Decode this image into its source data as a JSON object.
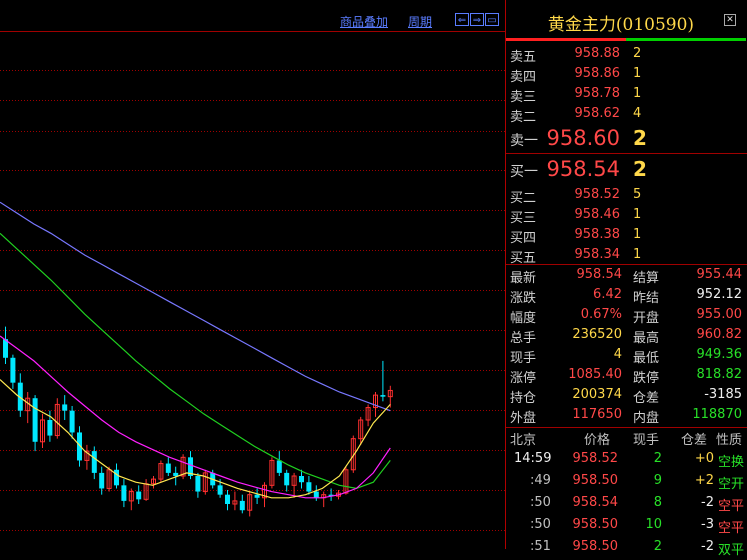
{
  "toolbar": {
    "overlay_label": "商品叠加",
    "period_label": "周期"
  },
  "quote": {
    "title": "黄金主力(010590)",
    "asks": [
      {
        "label": "卖五",
        "price": "958.88",
        "vol": "2"
      },
      {
        "label": "卖四",
        "price": "958.86",
        "vol": "1"
      },
      {
        "label": "卖三",
        "price": "958.78",
        "vol": "1"
      },
      {
        "label": "卖二",
        "price": "958.62",
        "vol": "4"
      },
      {
        "label": "卖一",
        "price": "958.60",
        "vol": "2"
      }
    ],
    "bids": [
      {
        "label": "买一",
        "price": "958.54",
        "vol": "2"
      },
      {
        "label": "买二",
        "price": "958.52",
        "vol": "5"
      },
      {
        "label": "买三",
        "price": "958.46",
        "vol": "1"
      },
      {
        "label": "买四",
        "price": "958.38",
        "vol": "1"
      },
      {
        "label": "买五",
        "price": "958.34",
        "vol": "1"
      }
    ],
    "stats": [
      {
        "l1": "最新",
        "v1": "958.54",
        "c1": "red",
        "l2": "结算",
        "v2": "955.44",
        "c2": "red"
      },
      {
        "l1": "涨跌",
        "v1": "6.42",
        "c1": "red",
        "l2": "昨结",
        "v2": "952.12",
        "c2": "white"
      },
      {
        "l1": "幅度",
        "v1": "0.67%",
        "c1": "red",
        "l2": "开盘",
        "v2": "955.00",
        "c2": "red"
      },
      {
        "l1": "总手",
        "v1": "236520",
        "c1": "yellow",
        "l2": "最高",
        "v2": "960.82",
        "c2": "red"
      },
      {
        "l1": "现手",
        "v1": "4",
        "c1": "yellow",
        "l2": "最低",
        "v2": "949.36",
        "c2": "green"
      },
      {
        "l1": "涨停",
        "v1": "1085.40",
        "c1": "red",
        "l2": "跌停",
        "v2": "818.82",
        "c2": "green"
      },
      {
        "l1": "持仓",
        "v1": "200374",
        "c1": "yellow",
        "l2": "仓差",
        "v2": "-3185",
        "c2": "white"
      },
      {
        "l1": "外盘",
        "v1": "117650",
        "c1": "red",
        "l2": "内盘",
        "v2": "118870",
        "c2": "green"
      }
    ],
    "ticks_header": {
      "time": "北京",
      "price": "价格",
      "vol": "现手",
      "diff": "仓差",
      "nature": "性质"
    },
    "ticks": [
      {
        "time": "14:59",
        "price": "958.52",
        "vol": "2",
        "diff": "+0",
        "nature": "空换",
        "nature_color": "green"
      },
      {
        "time": ":49",
        "price": "958.50",
        "vol": "9",
        "diff": "+2",
        "nature": "空开",
        "nature_color": "green"
      },
      {
        "time": ":50",
        "price": "958.54",
        "vol": "8",
        "diff": "-2",
        "nature": "空平",
        "nature_color": "red"
      },
      {
        "time": ":50",
        "price": "958.50",
        "vol": "10",
        "diff": "-3",
        "nature": "空平",
        "nature_color": "red"
      },
      {
        "time": ":51",
        "price": "958.50",
        "vol": "2",
        "diff": "-2",
        "nature": "双平",
        "nature_color": "green"
      }
    ]
  },
  "chart": {
    "candles": [
      [
        962.2,
        963.0,
        960.6,
        961.0
      ],
      [
        961.0,
        961.2,
        959.0,
        959.4
      ],
      [
        959.4,
        960.0,
        957.2,
        957.6
      ],
      [
        957.6,
        958.8,
        956.8,
        958.4
      ],
      [
        958.4,
        958.6,
        955.0,
        955.6
      ],
      [
        955.6,
        957.4,
        955.2,
        957.0
      ],
      [
        957.0,
        957.6,
        955.6,
        956.0
      ],
      [
        956.0,
        958.4,
        955.8,
        958.0
      ],
      [
        958.0,
        958.6,
        957.0,
        957.6
      ],
      [
        957.6,
        957.9,
        955.8,
        956.2
      ],
      [
        956.2,
        956.6,
        954.0,
        954.4
      ],
      [
        954.4,
        955.4,
        953.8,
        955.0
      ],
      [
        955.0,
        955.3,
        953.2,
        953.6
      ],
      [
        953.6,
        954.0,
        952.2,
        952.6
      ],
      [
        952.6,
        954.0,
        952.4,
        953.8
      ],
      [
        953.8,
        954.2,
        952.6,
        952.8
      ],
      [
        952.8,
        953.2,
        951.4,
        951.8
      ],
      [
        951.8,
        952.6,
        951.2,
        952.4
      ],
      [
        952.4,
        952.8,
        951.6,
        951.9
      ],
      [
        951.9,
        953.2,
        951.8,
        952.9
      ],
      [
        952.9,
        953.4,
        952.6,
        953.2
      ],
      [
        953.2,
        954.4,
        953.0,
        954.2
      ],
      [
        954.2,
        954.6,
        953.4,
        953.6
      ],
      [
        953.6,
        954.0,
        952.8,
        953.4
      ],
      [
        953.4,
        954.8,
        953.2,
        954.6
      ],
      [
        954.6,
        955.0,
        953.2,
        953.4
      ],
      [
        953.4,
        953.6,
        952.0,
        952.4
      ],
      [
        952.4,
        953.8,
        952.2,
        953.6
      ],
      [
        953.6,
        953.8,
        952.6,
        952.8
      ],
      [
        952.8,
        953.2,
        952.0,
        952.2
      ],
      [
        952.2,
        952.5,
        951.2,
        951.6
      ],
      [
        951.6,
        952.4,
        951.2,
        951.8
      ],
      [
        951.8,
        952.2,
        951.0,
        951.2
      ],
      [
        951.2,
        952.4,
        950.8,
        952.2
      ],
      [
        952.2,
        952.6,
        951.6,
        952.0
      ],
      [
        952.0,
        953.0,
        951.4,
        952.8
      ],
      [
        952.8,
        954.6,
        952.6,
        954.4
      ],
      [
        954.4,
        955.0,
        953.4,
        953.6
      ],
      [
        953.6,
        953.8,
        952.4,
        952.8
      ],
      [
        952.8,
        953.6,
        952.0,
        953.4
      ],
      [
        953.4,
        953.8,
        952.6,
        953.0
      ],
      [
        953.0,
        953.4,
        952.2,
        952.4
      ],
      [
        952.4,
        952.8,
        951.8,
        952.0
      ],
      [
        952.0,
        952.4,
        951.4,
        952.2
      ],
      [
        952.2,
        952.6,
        951.8,
        952.1
      ],
      [
        952.1,
        952.5,
        951.9,
        952.3
      ],
      [
        952.3,
        954.0,
        952.2,
        953.8
      ],
      [
        953.8,
        956.0,
        953.6,
        955.8
      ],
      [
        955.8,
        957.2,
        955.4,
        957.0
      ],
      [
        957.0,
        958.0,
        956.6,
        957.8
      ],
      [
        957.8,
        958.8,
        957.2,
        958.6
      ],
      [
        958.6,
        960.8,
        958.2,
        958.5
      ],
      [
        958.5,
        959.2,
        957.8,
        958.9
      ]
    ],
    "ma_blue": [
      971.0,
      970.3,
      969.6,
      969.0,
      968.3,
      967.6,
      967.0,
      966.4,
      965.8,
      965.2,
      964.6,
      964.0,
      963.4,
      962.8,
      962.2,
      961.6,
      961.0,
      960.4,
      959.8,
      959.3,
      958.8,
      958.4,
      958.0,
      957.6
    ],
    "ma_green": [
      969.0,
      968.0,
      967.0,
      966.0,
      964.9,
      963.8,
      962.8,
      961.8,
      960.8,
      959.9,
      959.0,
      958.2,
      957.4,
      956.7,
      956.0,
      955.3,
      954.7,
      954.1,
      953.6,
      953.2,
      952.8,
      952.6,
      953.0,
      954.4
    ],
    "ma_magenta": [
      962.4,
      961.6,
      960.8,
      959.8,
      958.8,
      957.9,
      957.0,
      956.2,
      955.6,
      955.1,
      954.6,
      954.2,
      953.8,
      953.4,
      953.0,
      952.7,
      952.4,
      952.2,
      952.0,
      952.0,
      952.2,
      952.6,
      953.6,
      955.2
    ],
    "ma_yellow": [
      959.6,
      958.6,
      957.8,
      957.2,
      956.2,
      955.0,
      954.2,
      953.4,
      953.0,
      952.8,
      953.2,
      953.6,
      953.4,
      953.0,
      952.6,
      952.3,
      952.0,
      952.0,
      952.2,
      952.6,
      953.4,
      955.0,
      956.8,
      958.0
    ]
  },
  "colors": {
    "grid": "#a00000",
    "up": "#ff3030",
    "down": "#00e8ff",
    "ma_blue": "#7878ff",
    "ma_green": "#20d020",
    "ma_magenta": "#ff20ff",
    "ma_yellow": "#ffe850"
  }
}
